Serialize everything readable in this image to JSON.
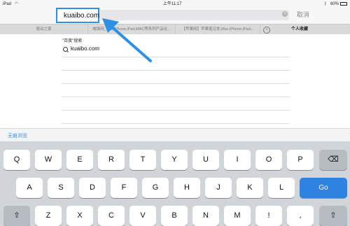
{
  "status": {
    "device": "iPad",
    "time": "上午11:17",
    "battery": "60%"
  },
  "address": {
    "url": "kuaibo.com",
    "cancel_label": "取消",
    "clear_icon": "clear-circle-icon"
  },
  "tabs": [
    "驱动之家",
    "威锋网_苹果iPhone,iPad,MAC等系列产品论...",
    "【苹果网】苹果笔记本,Mac,iPhone,iPad..."
  ],
  "favorites_tab": "个人收藏",
  "suggestions": {
    "header": "\"百度\"搜索",
    "items": [
      "kuaibo.com"
    ]
  },
  "private_browsing": "无痕浏览",
  "keyboard": {
    "row1": [
      "Q",
      "W",
      "E",
      "R",
      "T",
      "Y",
      "U",
      "I",
      "O",
      "P"
    ],
    "row2": [
      "A",
      "S",
      "D",
      "F",
      "G",
      "H",
      "J",
      "K",
      "L"
    ],
    "row3": [
      "Z",
      "X",
      "C",
      "V",
      "B",
      "N",
      "M",
      "!",
      ","
    ],
    "go": "Go",
    "backspace_icon": "backspace-icon",
    "shift_icon": "shift-icon"
  },
  "annotation": {
    "color": "#2e8fe6"
  }
}
